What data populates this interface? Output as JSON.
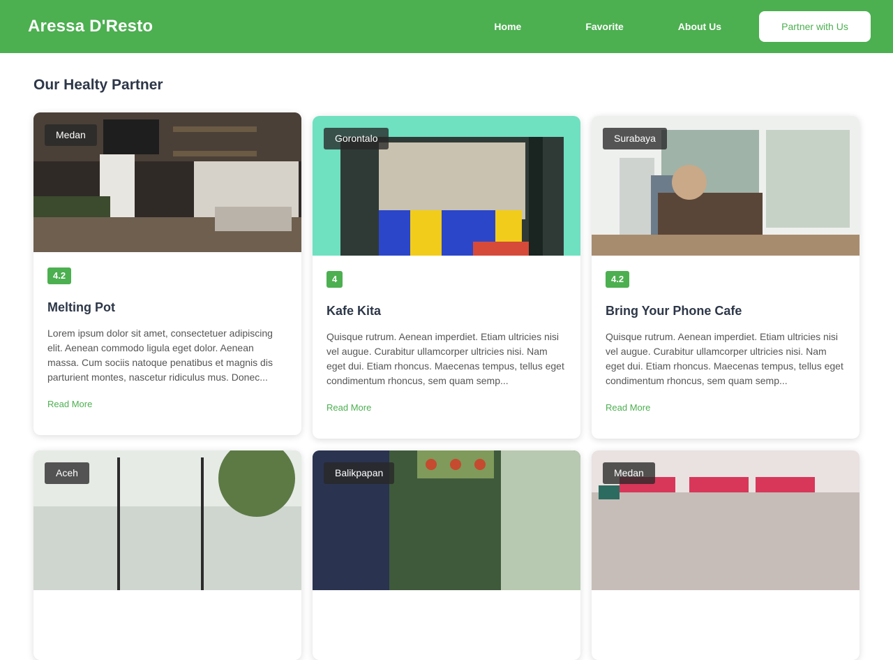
{
  "header": {
    "brand": "Aressa D'Resto",
    "nav": [
      "Home",
      "Favorite",
      "About Us"
    ],
    "partner_button": "Partner with Us"
  },
  "main": {
    "title": "Our Healty Partner",
    "cards": [
      {
        "city": "Medan",
        "rating": "4.2",
        "name": "Melting Pot",
        "description": "Lorem ipsum dolor sit amet, consectetuer adipiscing elit. Aenean commodo ligula eget dolor. Aenean massa. Cum sociis natoque penatibus et magnis dis parturient montes, nascetur ridiculus mus. Donec...",
        "link": "Read More"
      },
      {
        "city": "Gorontalo",
        "rating": "4",
        "name": "Kafe Kita",
        "description": "Quisque rutrum. Aenean imperdiet. Etiam ultricies nisi vel augue. Curabitur ullamcorper ultricies nisi. Nam eget dui. Etiam rhoncus. Maecenas tempus, tellus eget condimentum rhoncus, sem quam semp...",
        "link": "Read More"
      },
      {
        "city": "Surabaya",
        "rating": "4.2",
        "name": "Bring Your Phone Cafe",
        "description": "Quisque rutrum. Aenean imperdiet. Etiam ultricies nisi vel augue. Curabitur ullamcorper ultricies nisi. Nam eget dui. Etiam rhoncus. Maecenas tempus, tellus eget condimentum rhoncus, sem quam semp...",
        "link": "Read More"
      },
      {
        "city": "Aceh"
      },
      {
        "city": "Balikpapan"
      },
      {
        "city": "Medan"
      }
    ]
  },
  "colors": {
    "accent": "#4caf50",
    "text": "#2d3748"
  }
}
